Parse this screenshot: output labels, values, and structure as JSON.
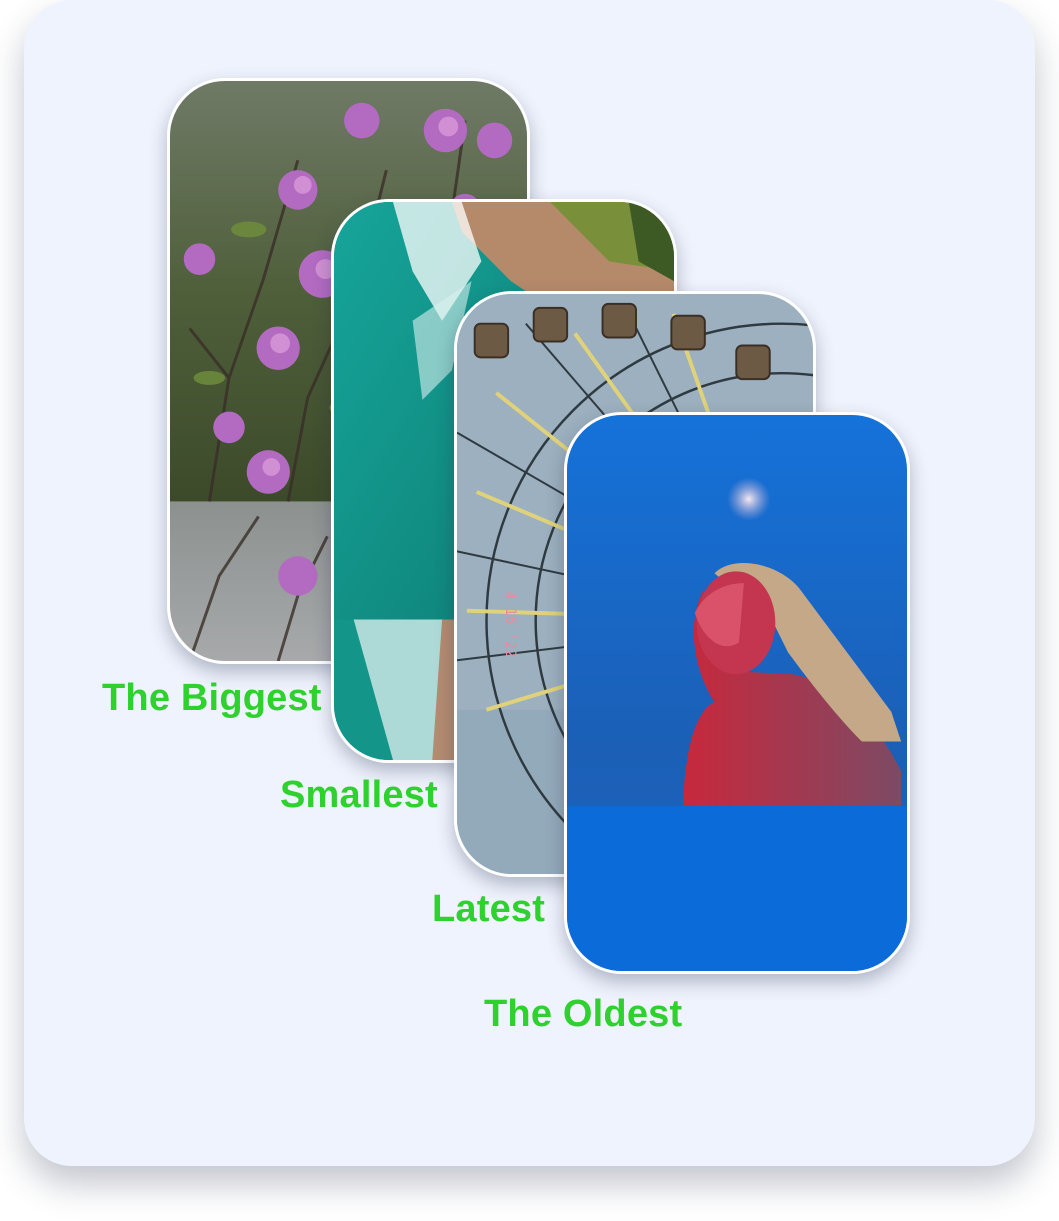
{
  "labels": {
    "biggest": "The Biggest",
    "smallest": "Smallest",
    "latest": "Latest",
    "oldest": "The Oldest"
  },
  "images": [
    {
      "key": "biggest",
      "icon": "flowers-photo"
    },
    {
      "key": "smallest",
      "icon": "ocean-coast-photo"
    },
    {
      "key": "latest",
      "icon": "ferris-wheel-photo"
    },
    {
      "key": "oldest",
      "icon": "portrait-moon-photo"
    }
  ],
  "colors": {
    "label": "#2ed12e",
    "panel": "#eff3fd",
    "card_border": "#ffffff"
  }
}
